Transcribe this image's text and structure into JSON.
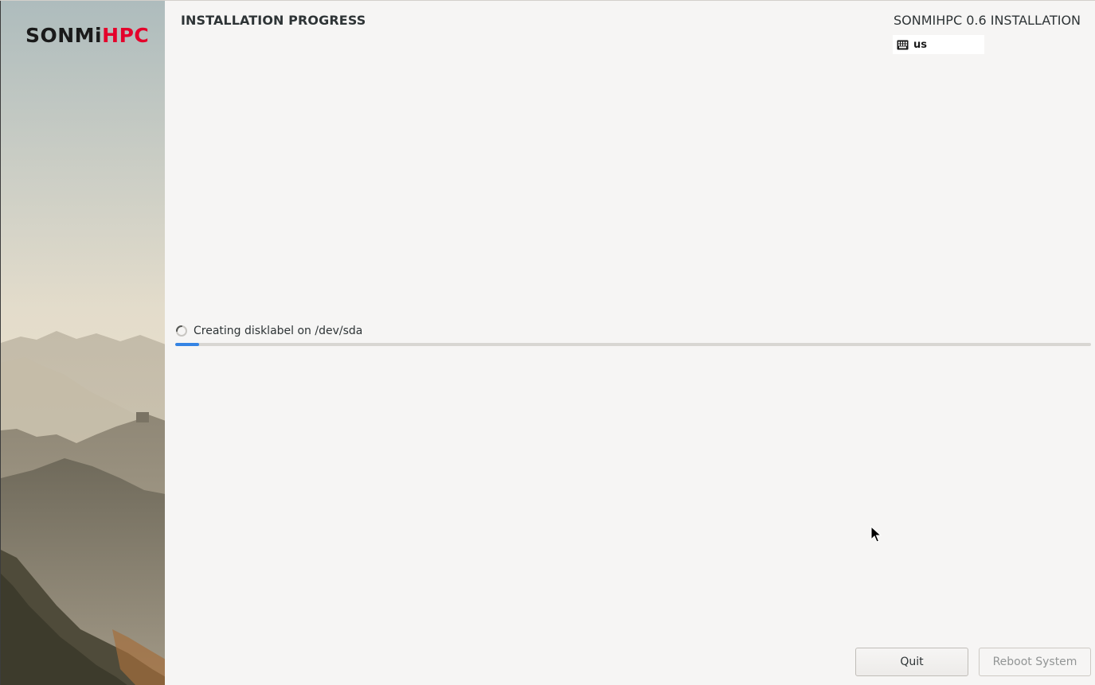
{
  "branding": {
    "logo_part1": "SONMi",
    "logo_part2": "HPC",
    "logo_colors": {
      "dark": "#1a1a1a",
      "red": "#e4002b"
    }
  },
  "header": {
    "page_title": "INSTALLATION PROGRESS",
    "product_title": "SONMIHPC 0.6 INSTALLATION",
    "keyboard_layout": "us",
    "keyboard_icon": "keyboard-icon"
  },
  "progress": {
    "status_text": "Creating disklabel on /dev/sda",
    "spinner_icon": "spinner-icon",
    "fraction": 0.026,
    "bar_color": "#3584e4"
  },
  "footer": {
    "quit_label": "Quit",
    "reboot_label": "Reboot System",
    "reboot_enabled": false
  },
  "colors": {
    "background": "#f6f5f4",
    "text": "#2e3436"
  }
}
